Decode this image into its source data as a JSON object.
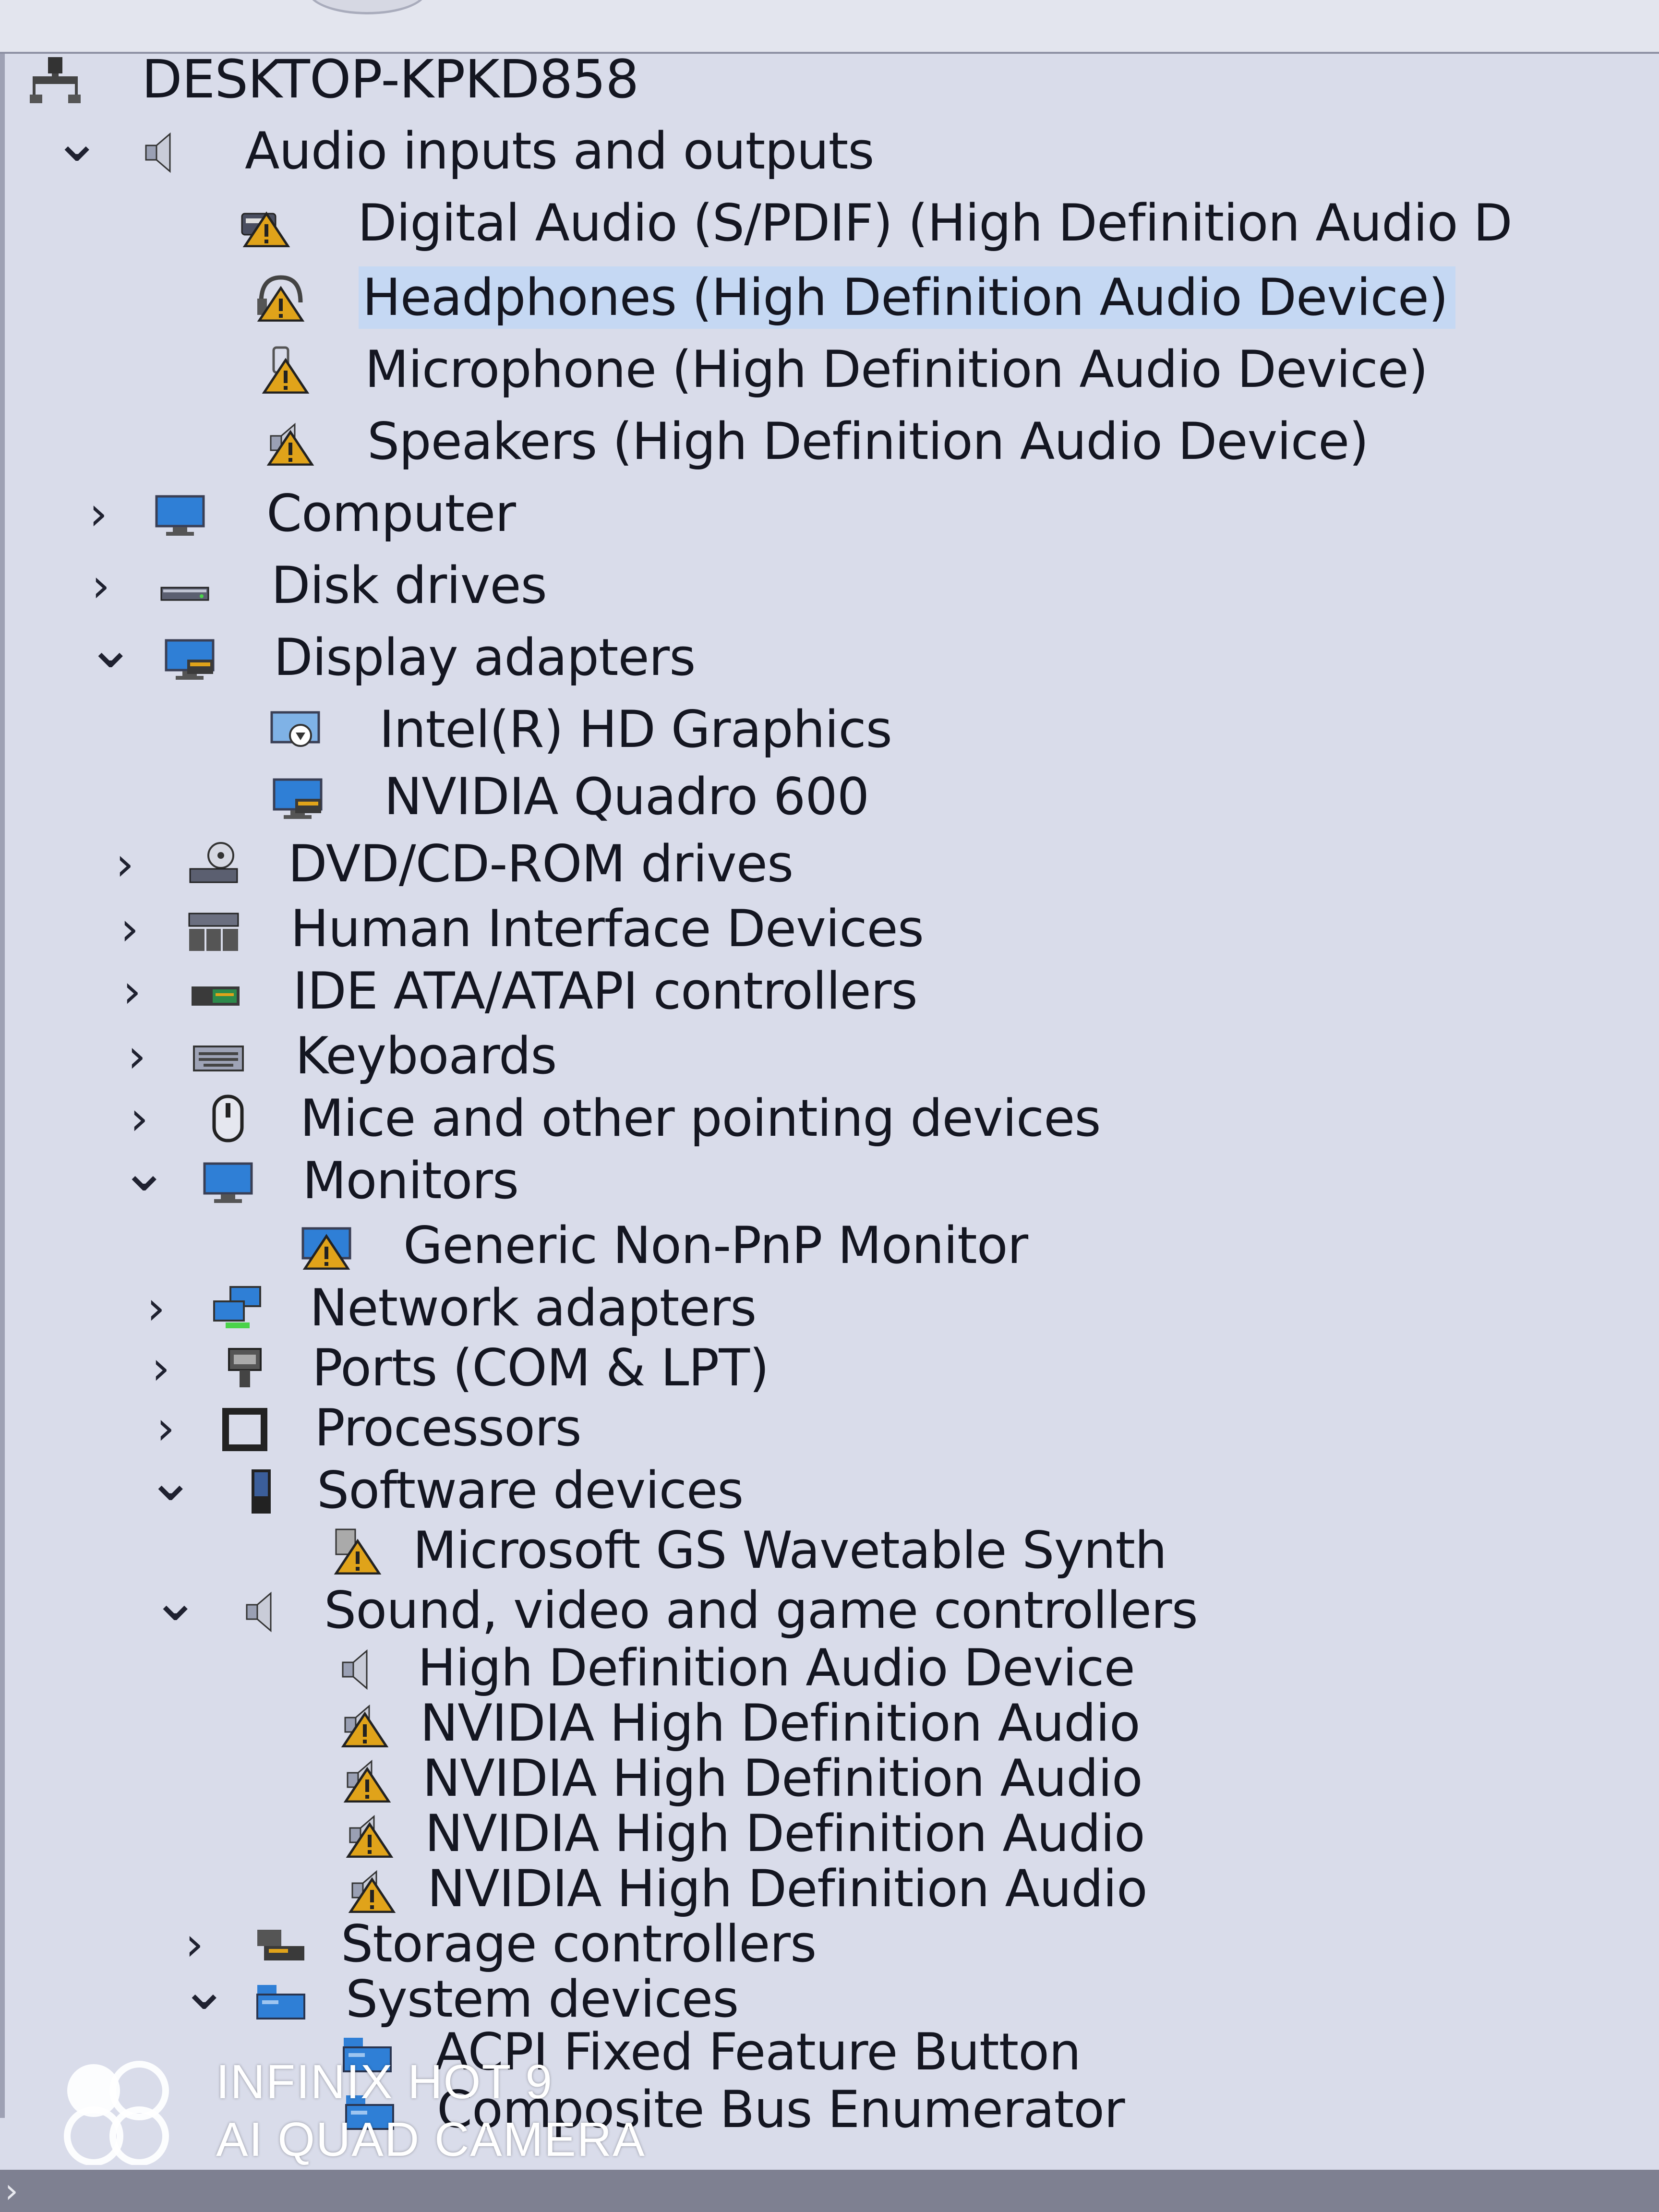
{
  "window": {
    "computer_name": "DESKTOP-KPKD858"
  },
  "tree": [
    {
      "key": "computer_root",
      "label": "DESKTOP-KPKD858",
      "expander": "",
      "icon": "computer-root-icon"
    },
    {
      "key": "audio_io",
      "label": "Audio inputs and outputs",
      "expander": "expanded",
      "icon": "speaker-icon"
    },
    {
      "key": "audio_io_spdif",
      "label": "Digital Audio (S/PDIF) (High Definition Audio D",
      "expander": "",
      "icon": "spdif-warning-icon"
    },
    {
      "key": "audio_io_headphones",
      "label": "Headphones (High Definition Audio Device)",
      "expander": "",
      "icon": "headphones-warning-icon",
      "selected": true
    },
    {
      "key": "audio_io_microphone",
      "label": "Microphone (High Definition Audio Device)",
      "expander": "",
      "icon": "microphone-warning-icon"
    },
    {
      "key": "audio_io_speakers",
      "label": "Speakers (High Definition Audio Device)",
      "expander": "",
      "icon": "speaker-warning-icon"
    },
    {
      "key": "computer",
      "label": "Computer",
      "expander": "collapsed",
      "icon": "monitor-icon"
    },
    {
      "key": "disk_drives",
      "label": "Disk drives",
      "expander": "collapsed",
      "icon": "disk-drive-icon"
    },
    {
      "key": "display_adapters",
      "label": "Display adapters",
      "expander": "expanded",
      "icon": "display-adapter-icon"
    },
    {
      "key": "intel_hd",
      "label": "Intel(R) HD Graphics",
      "expander": "",
      "icon": "display-adapter-disabled-icon"
    },
    {
      "key": "nvidia_quadro",
      "label": "NVIDIA Quadro 600",
      "expander": "",
      "icon": "display-adapter-icon"
    },
    {
      "key": "dvd",
      "label": "DVD/CD-ROM drives",
      "expander": "collapsed",
      "icon": "dvd-drive-icon"
    },
    {
      "key": "hid",
      "label": "Human Interface Devices",
      "expander": "collapsed",
      "icon": "hid-icon"
    },
    {
      "key": "ide",
      "label": "IDE ATA/ATAPI controllers",
      "expander": "collapsed",
      "icon": "ide-controller-icon"
    },
    {
      "key": "keyboards",
      "label": "Keyboards",
      "expander": "collapsed",
      "icon": "keyboard-icon"
    },
    {
      "key": "mice",
      "label": "Mice and other pointing devices",
      "expander": "collapsed",
      "icon": "mouse-icon"
    },
    {
      "key": "monitors",
      "label": "Monitors",
      "expander": "expanded",
      "icon": "monitor-icon"
    },
    {
      "key": "generic_monitor",
      "label": "Generic Non-PnP Monitor",
      "expander": "",
      "icon": "monitor-warning-icon"
    },
    {
      "key": "network",
      "label": "Network adapters",
      "expander": "collapsed",
      "icon": "network-adapter-icon"
    },
    {
      "key": "ports",
      "label": "Ports (COM & LPT)",
      "expander": "collapsed",
      "icon": "port-icon"
    },
    {
      "key": "processors",
      "label": "Processors",
      "expander": "collapsed",
      "icon": "processor-icon"
    },
    {
      "key": "software_devices",
      "label": "Software devices",
      "expander": "expanded",
      "icon": "software-device-icon"
    },
    {
      "key": "gs_synth",
      "label": "Microsoft GS Wavetable Synth",
      "expander": "",
      "icon": "generic-warning-icon"
    },
    {
      "key": "sound_video",
      "label": "Sound, video and game controllers",
      "expander": "expanded",
      "icon": "speaker-icon"
    },
    {
      "key": "hd_audio_device",
      "label": "High Definition Audio Device",
      "expander": "",
      "icon": "speaker-icon"
    },
    {
      "key": "nvidia_audio_1",
      "label": "NVIDIA High Definition Audio",
      "expander": "",
      "icon": "speaker-warning-icon"
    },
    {
      "key": "nvidia_audio_2",
      "label": "NVIDIA High Definition Audio",
      "expander": "",
      "icon": "speaker-warning-icon"
    },
    {
      "key": "nvidia_audio_3",
      "label": "NVIDIA High Definition Audio",
      "expander": "",
      "icon": "speaker-warning-icon"
    },
    {
      "key": "nvidia_audio_4",
      "label": "NVIDIA High Definition Audio",
      "expander": "",
      "icon": "speaker-warning-icon"
    },
    {
      "key": "storage",
      "label": "Storage controllers",
      "expander": "collapsed",
      "icon": "storage-controller-icon"
    },
    {
      "key": "system_devices",
      "label": "System devices",
      "expander": "expanded",
      "icon": "system-device-icon"
    },
    {
      "key": "acpi_button",
      "label": "ACPI Fixed Feature Button",
      "expander": "",
      "icon": "system-device-icon"
    },
    {
      "key": "composite_bus",
      "label": "Composite Bus Enumerator",
      "expander": "",
      "icon": "system-device-icon"
    }
  ],
  "watermark": {
    "line1": "INFINIX HOT 9",
    "line2": "AI QUAD CAMERA"
  },
  "colors": {
    "background": "#d9dcea",
    "selection": "#c5d8f3",
    "warning_triangle": "#e0a31a",
    "monitor_blue": "#2f7fd6"
  }
}
